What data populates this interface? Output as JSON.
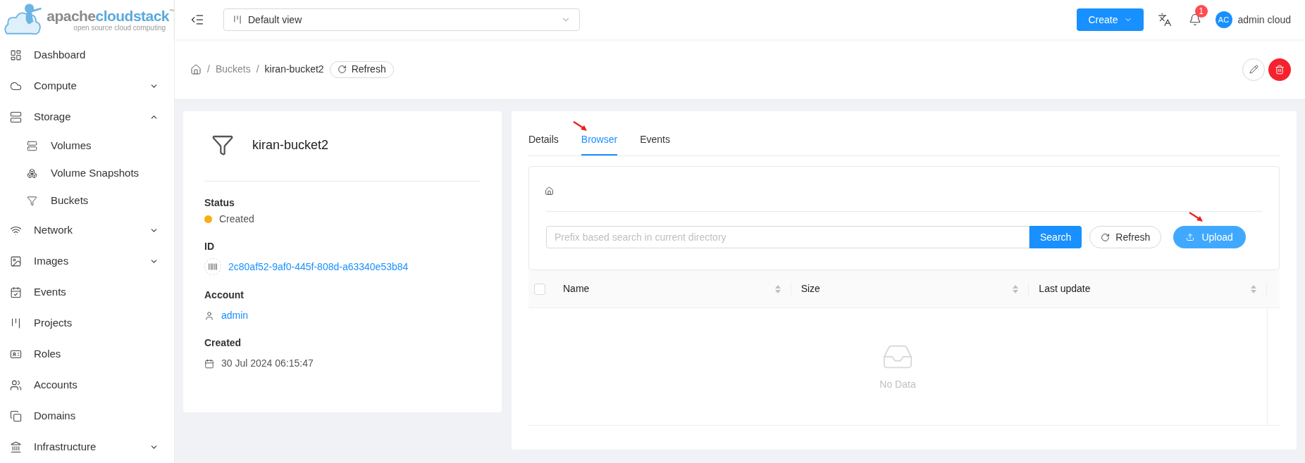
{
  "logo": {
    "word_a": "apache",
    "word_b": "cloudstack",
    "trademark": "™",
    "tagline": "open source cloud computing"
  },
  "header": {
    "view_select": "Default view",
    "create_button": "Create",
    "notification_count": "1",
    "user_initials": "AC",
    "user_name": "admin cloud"
  },
  "sidebar": {
    "items": [
      {
        "label": "Dashboard"
      },
      {
        "label": "Compute",
        "expanded": false
      },
      {
        "label": "Storage",
        "expanded": true,
        "children": [
          {
            "label": "Volumes"
          },
          {
            "label": "Volume Snapshots"
          },
          {
            "label": "Buckets"
          }
        ]
      },
      {
        "label": "Network",
        "expanded": false
      },
      {
        "label": "Images",
        "expanded": false
      },
      {
        "label": "Events"
      },
      {
        "label": "Projects"
      },
      {
        "label": "Roles"
      },
      {
        "label": "Accounts"
      },
      {
        "label": "Domains"
      },
      {
        "label": "Infrastructure",
        "expanded": false
      }
    ]
  },
  "breadcrumb": {
    "separator": "/",
    "items": [
      "Buckets",
      "kiran-bucket2"
    ],
    "refresh_button": "Refresh"
  },
  "details_card": {
    "title": "kiran-bucket2",
    "fields": [
      {
        "kind": "status",
        "label": "Status",
        "value": "Created"
      },
      {
        "kind": "id",
        "label": "ID",
        "value": "2c80af52-9af0-445f-808d-a63340e53b84"
      },
      {
        "kind": "account",
        "label": "Account",
        "value": "admin"
      },
      {
        "kind": "date",
        "label": "Created",
        "value": "30 Jul 2024 06:15:47"
      }
    ]
  },
  "tabs": [
    {
      "label": "Details",
      "selected": false
    },
    {
      "label": "Browser",
      "selected": true
    },
    {
      "label": "Events",
      "selected": false
    }
  ],
  "browser": {
    "search": {
      "placeholder": "Prefix based search in current directory"
    },
    "search_button": "Search",
    "refresh_button": "Refresh",
    "upload_button": "Upload",
    "table": {
      "select_all_checked": false,
      "columns": [
        "Name",
        "Size",
        "Last update"
      ],
      "empty_text": "No Data"
    }
  }
}
